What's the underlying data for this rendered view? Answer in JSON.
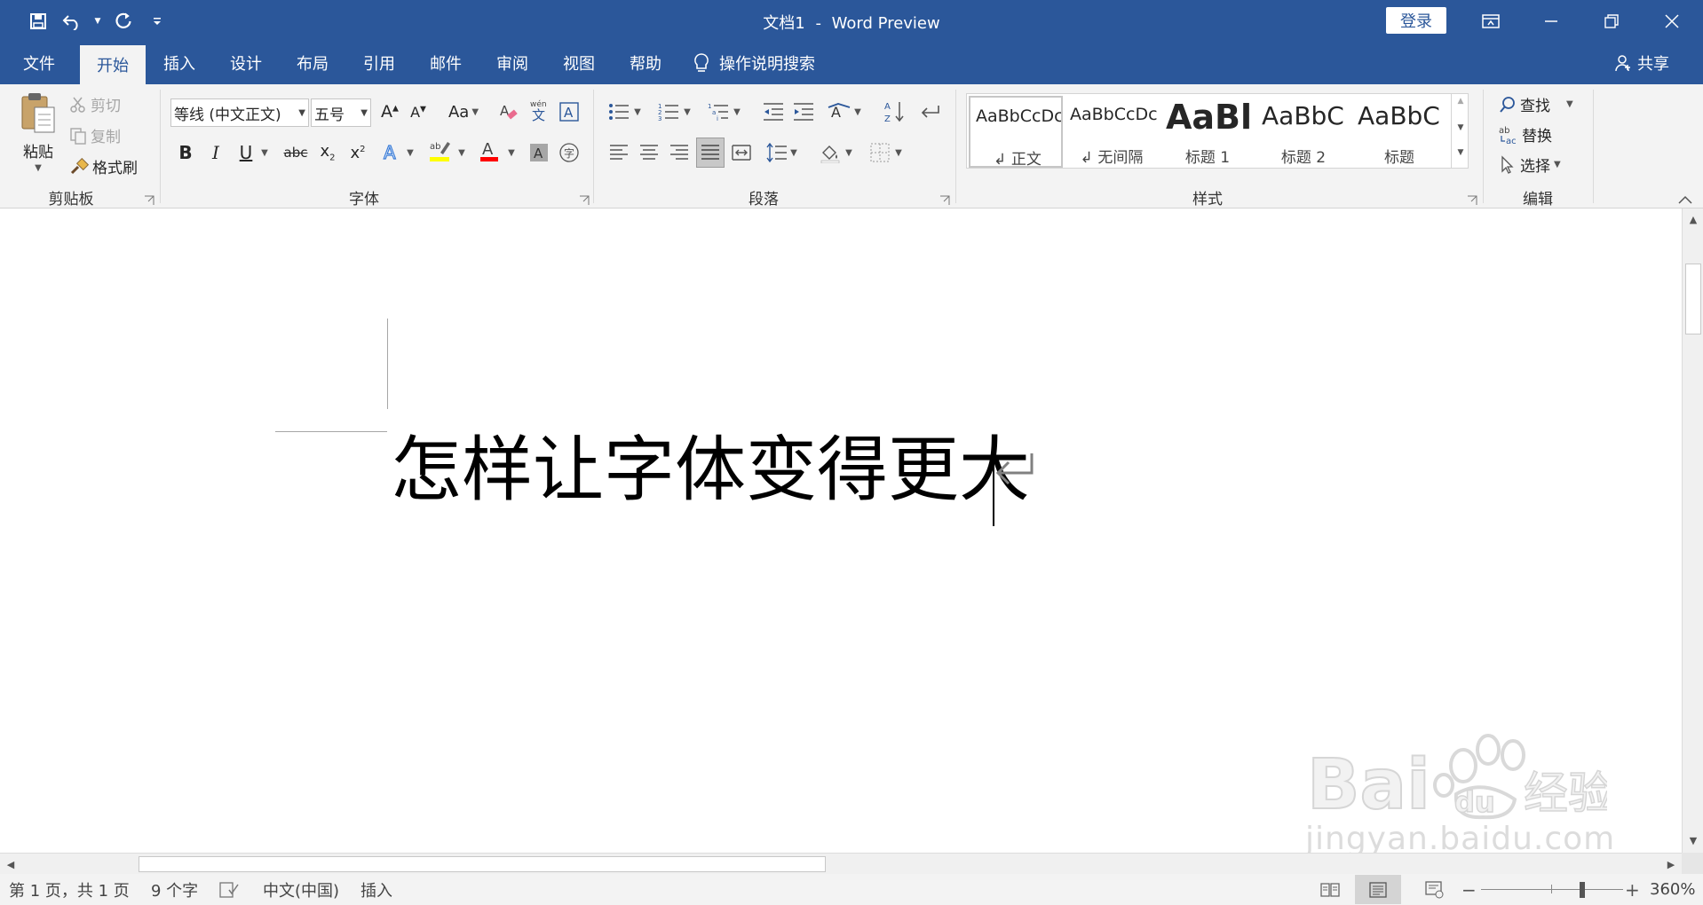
{
  "app": {
    "doc_title": "文档1",
    "separator": "-",
    "app_name": "Word Preview",
    "signin_label": "登录"
  },
  "tabs": [
    "文件",
    "开始",
    "插入",
    "设计",
    "布局",
    "引用",
    "邮件",
    "审阅",
    "视图",
    "帮助"
  ],
  "active_tab": "开始",
  "tell_me": "操作说明搜索",
  "share_label": "共享",
  "ribbon": {
    "clipboard": {
      "paste": "粘贴",
      "cut": "剪切",
      "copy": "复制",
      "format_painter": "格式刷",
      "group_label": "剪贴板"
    },
    "font": {
      "font_name": "等线 (中文正文)",
      "font_size": "五号",
      "bold": "B",
      "italic": "I",
      "underline": "U",
      "strike": "abc",
      "change_case": "Aa",
      "group_label": "字体"
    },
    "paragraph": {
      "group_label": "段落"
    },
    "styles": {
      "items": [
        {
          "sample": "AaBbCcDc",
          "name": "↲ 正文"
        },
        {
          "sample": "AaBbCcDc",
          "name": "↲ 无间隔"
        },
        {
          "sample": "AaBl",
          "name": "标题 1"
        },
        {
          "sample": "AaBbC",
          "name": "标题 2"
        },
        {
          "sample": "AaBbC",
          "name": "标题"
        }
      ],
      "group_label": "样式"
    },
    "editing": {
      "find": "查找",
      "replace": "替换",
      "select": "选择",
      "group_label": "编辑"
    }
  },
  "document": {
    "text": "怎样让字体变得更大"
  },
  "watermark": {
    "url": "jingyan.baidu.com"
  },
  "status": {
    "page": "第 1 页，共 1 页",
    "words": "9 个字",
    "language": "中文(中国)",
    "mode": "插入",
    "zoom": "360%",
    "zoom_level": 0.72
  },
  "colors": {
    "brand": "#2b579a",
    "highlight": "#ffff00",
    "font_color": "#ff0000"
  }
}
